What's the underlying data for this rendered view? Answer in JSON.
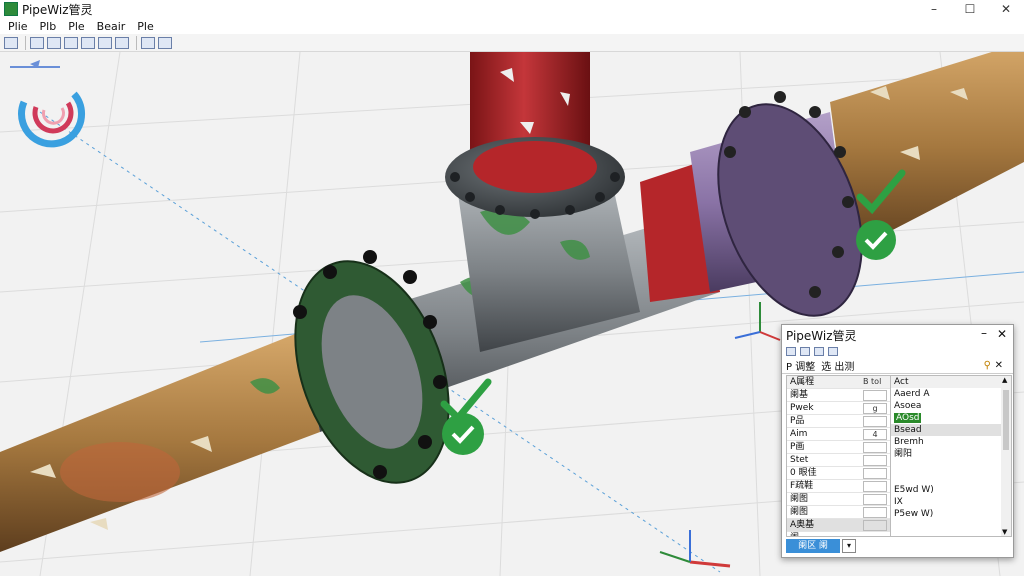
{
  "window": {
    "title": "PipeWiz管灵",
    "minimize": "–",
    "maximize": "☐",
    "close": "✕"
  },
  "menu": [
    "Plie",
    "Plb",
    "Ple",
    "Beair",
    "Ple"
  ],
  "toolbar": {
    "icons": [
      "copy-icon",
      "undo-icon",
      "save-icon",
      "rotate-icon",
      "grid-icon",
      "view-icon",
      "layers-icon",
      "pan-icon",
      "frame-icon"
    ]
  },
  "colors": {
    "pipe_rust": "#a5783f",
    "pipe_gray": "#7d8286",
    "pipe_red": "#b5262a",
    "pipe_purple": "#8a73a6",
    "paint_green": "#3f8f45",
    "check_green": "#2ea043",
    "accent_blue": "#3a8fd8"
  },
  "panel": {
    "title": "PipeWiz管灵",
    "minimize": "–",
    "close": "✕",
    "tabs": [
      "P  调整",
      "选 出测"
    ],
    "pin": "⚲",
    "tab_close": "✕",
    "left_header": "A属程",
    "left_header2": "B tol",
    "left_rows": [
      {
        "label": "阑基",
        "value": ""
      },
      {
        "label": "Pwek",
        "value": "g"
      },
      {
        "label": "P品",
        "value": ""
      },
      {
        "label": "Aim",
        "value": "4"
      },
      {
        "label": "P画",
        "value": ""
      },
      {
        "label": "Stet",
        "value": ""
      },
      {
        "label": "0 眼佳",
        "value": ""
      },
      {
        "label": "F疏鞋",
        "value": ""
      },
      {
        "label": "阑图",
        "value": ""
      },
      {
        "label": "阑图",
        "value": ""
      },
      {
        "label": "A奥基",
        "value": ""
      },
      {
        "label": "阑",
        "value": ""
      }
    ],
    "right_header": "Act",
    "right_rows": [
      "Aaerd A",
      "Asoea",
      "AOsd",
      "Bsead",
      "Bremh",
      "阑阳",
      "",
      "",
      "E5wd W)",
      "IX",
      "P5ew W)"
    ],
    "ok_label": "阑区 阑",
    "dropdown": "▾"
  }
}
